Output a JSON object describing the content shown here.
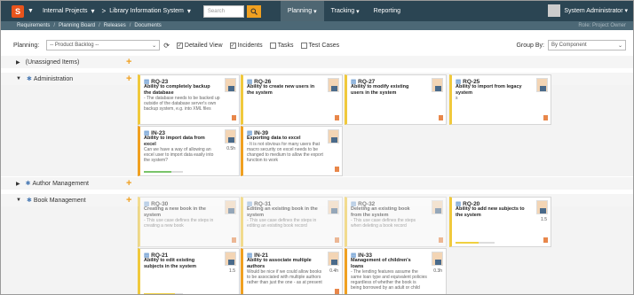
{
  "topbar": {
    "nav1": "Internal Projects",
    "nav2": "Library Information System",
    "search_placeholder": "Search",
    "menus": [
      "Planning",
      "Tracking",
      "Reporting"
    ],
    "user": "System Administrator"
  },
  "breadcrumb": [
    "Requirements",
    "Planning Board",
    "Releases",
    "Documents"
  ],
  "breadcrumb_right": "Role: Project Owner",
  "planning": {
    "label": "Planning:",
    "select": "-- Product Backlog --",
    "checks": [
      {
        "label": "Detailed View",
        "checked": true
      },
      {
        "label": "Incidents",
        "checked": true
      },
      {
        "label": "Tasks",
        "checked": false
      },
      {
        "label": "Test Cases",
        "checked": false
      }
    ],
    "groupby_label": "Group By:",
    "groupby_value": "By Component"
  },
  "lanes": [
    {
      "name": "(Unassigned Items)",
      "collapsed": true
    },
    {
      "name": "Administration",
      "collapsed": false
    },
    {
      "name": "Author Management",
      "collapsed": true
    },
    {
      "name": "Book Management",
      "collapsed": false
    }
  ],
  "cards": [
    {
      "id": "RQ-23",
      "title": "Ability to completely backup the database",
      "desc": "- The database needs to be backed up outside of the database server's own backup system, e.g. into XML files",
      "est": "",
      "progress": 0,
      "badge": true
    },
    {
      "id": "RQ-26",
      "title": "Ability to create new users in the system",
      "desc": "",
      "est": "",
      "progress": 0,
      "badge": true
    },
    {
      "id": "RQ-27",
      "title": "Ability to modify existing users in the system",
      "desc": "",
      "est": "",
      "progress": 0,
      "badge": true
    },
    {
      "id": "RQ-25",
      "title": "Ability to import from legacy system",
      "desc": "s",
      "est": "",
      "progress": 0,
      "badge": true
    },
    {
      "id": "IN-23",
      "title": "Ability to import data from excel",
      "desc": "Can we have a way of allowing an excel user to import data easily into the system?",
      "est": "0.5h",
      "progress": 0.7,
      "badge": false
    },
    {
      "id": "IN-39",
      "title": "Exporting data to excel",
      "desc": "- It is not obvious for many users that macro security on excel needs to be changed to medium to allow the export function to work",
      "est": "",
      "progress": 0,
      "badge": true
    },
    {
      "id": "RQ-30",
      "title": "Creating a new book in the system",
      "desc": "- This use case defines the steps in creating a new book",
      "est": "",
      "progress": 0,
      "badge": true
    },
    {
      "id": "RQ-31",
      "title": "Editing an existing book in the system",
      "desc": "- This use case defines the steps in editing an existing book record",
      "est": "",
      "progress": 0,
      "badge": true
    },
    {
      "id": "RQ-32",
      "title": "Deleting an existing book from the system",
      "desc": "- This use case defines the steps when deleting a book record",
      "est": "",
      "progress": 0,
      "badge": true
    },
    {
      "id": "RQ-20",
      "title": "Ability to add new subjects to the system",
      "desc": "",
      "est": "1.5",
      "progress": 0.6,
      "badge": true
    },
    {
      "id": "RQ-21",
      "title": "Ability to edit existing subjects in the system",
      "desc": "",
      "est": "1.5",
      "progress": 0.8,
      "badge": false
    },
    {
      "id": "IN-21",
      "title": "Ability to associate multiple authors",
      "desc": "Would be nice if we could allow books to be associated with multiple authors rather than just the one - as at present",
      "est": "0.4h",
      "progress": 0,
      "badge": true
    },
    {
      "id": "IN-33",
      "title": "Management of children's loans",
      "desc": "- The lending features assume the same loan type and equivalent policies regardless of whether the book is being borrowed by an adult or child",
      "est": "0.3h",
      "progress": 0,
      "badge": false
    }
  ],
  "colors": {
    "topbar": "#2b4553",
    "accent": "#f0a020",
    "card_border": "#f0c93c"
  }
}
